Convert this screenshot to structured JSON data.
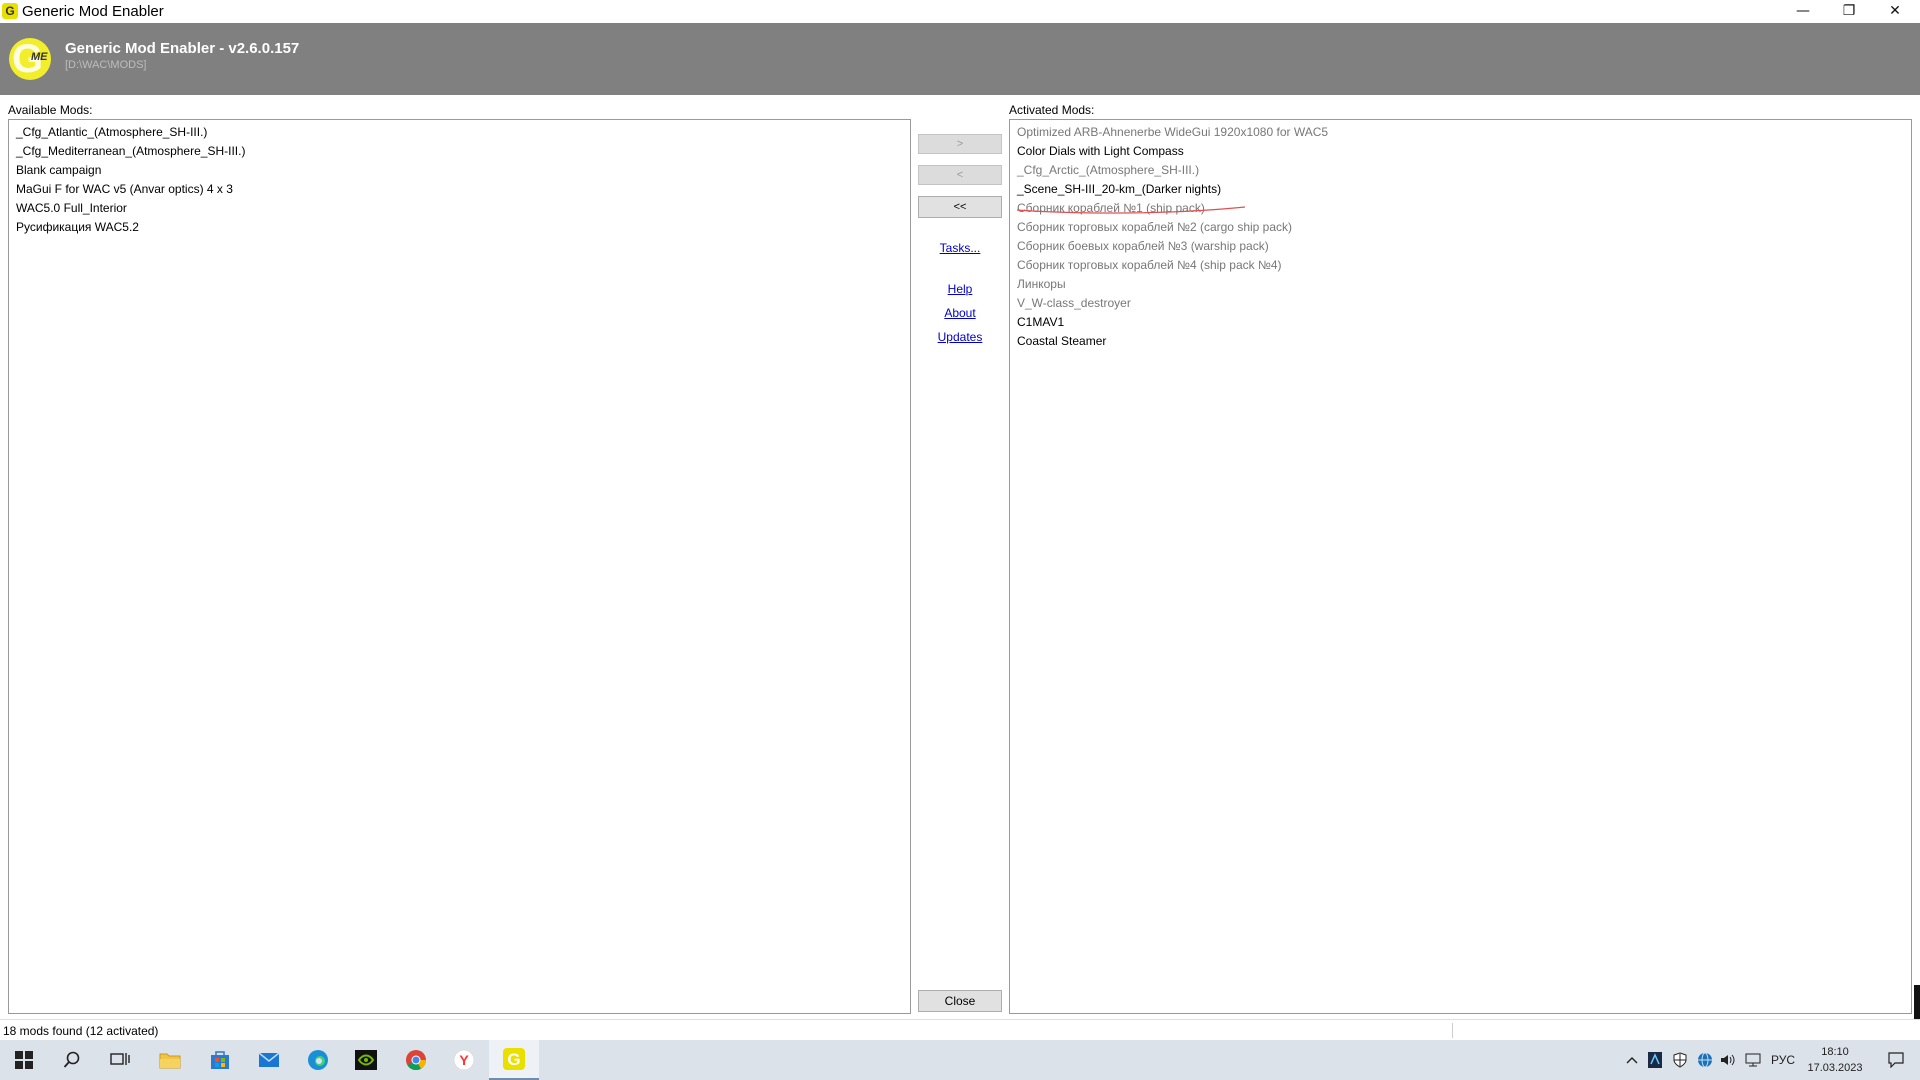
{
  "window": {
    "title": "Generic Mod Enabler",
    "icon_letter": "G",
    "controls": {
      "minimize": "—",
      "restore": "❐",
      "close": "✕"
    }
  },
  "header": {
    "logo_letter": "G",
    "logo_sub": "ME",
    "title": "Generic Mod Enabler - v2.6.0.157",
    "path": "[D:\\WAC\\MODS]"
  },
  "available": {
    "label": "Available Mods:",
    "items": [
      "_Cfg_Atlantic_(Atmosphere_SH-III.)",
      "_Cfg_Mediterranean_(Atmosphere_SH-III.)",
      "Blank campaign",
      "MaGui F for WAC v5 (Anvar optics) 4 x 3",
      "WAC5.0 Full_Interior",
      "Русификация WAC5.2"
    ]
  },
  "activated": {
    "label": "Activated Mods:",
    "items": [
      {
        "text": "Optimized ARB-Ahnenerbe WideGui 1920x1080 for WAC5",
        "dim": true
      },
      {
        "text": "Color Dials with Light Compass",
        "dim": false
      },
      {
        "text": "_Cfg_Arctic_(Atmosphere_SH-III.)",
        "dim": true
      },
      {
        "text": "_Scene_SH-III_20-km_(Darker nights)",
        "dim": false
      },
      {
        "text": "Сборник кораблей №1 (ship pack)",
        "dim": true
      },
      {
        "text": "Сборник торговых кораблей №2 (cargo ship pack)",
        "dim": true
      },
      {
        "text": "Сборник боевых кораблей №3 (warship pack)",
        "dim": true
      },
      {
        "text": "Сборник торговых кораблей №4 (ship pack №4)",
        "dim": true
      },
      {
        "text": "Линкоры",
        "dim": true
      },
      {
        "text": "V_W-class_destroyer",
        "dim": true
      },
      {
        "text": "C1MAV1",
        "dim": false
      },
      {
        "text": "Coastal Steamer",
        "dim": false
      }
    ]
  },
  "middle": {
    "activate_label": ">",
    "deactivate_label": "<",
    "deactivate_all_label": "<<",
    "tasks_link": "Tasks...",
    "help_link": "Help",
    "about_link": "About",
    "updates_link": "Updates",
    "close_label": "Close"
  },
  "status": {
    "text": "18 mods found (12 activated)"
  },
  "taskbar": {
    "language": "РУС",
    "time": "18:10",
    "date": "17.03.2023"
  },
  "colors": {
    "header_bg": "#808080",
    "link": "#0000cc",
    "annotation": "#e05050"
  }
}
